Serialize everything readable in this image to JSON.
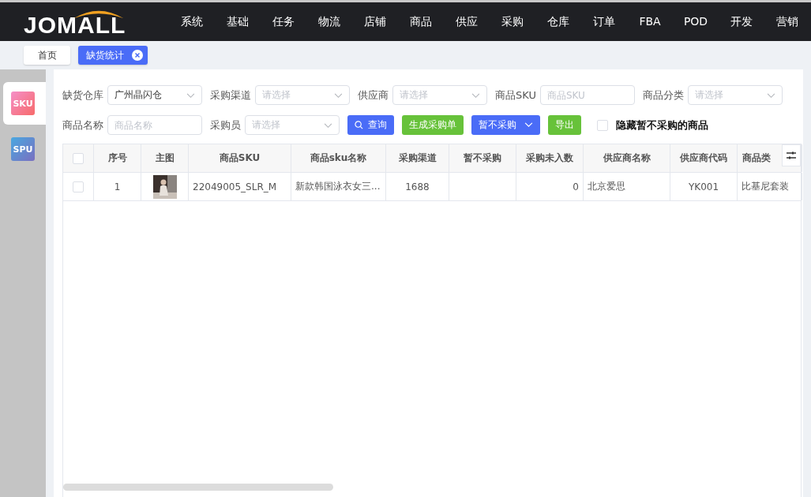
{
  "logo": {
    "text": "JOMALL"
  },
  "nav": [
    {
      "label": "系统"
    },
    {
      "label": "基础"
    },
    {
      "label": "任务"
    },
    {
      "label": "物流"
    },
    {
      "label": "店铺"
    },
    {
      "label": "商品"
    },
    {
      "label": "供应"
    },
    {
      "label": "采购"
    },
    {
      "label": "仓库"
    },
    {
      "label": "订单"
    },
    {
      "label": "FBA"
    },
    {
      "label": "POD"
    },
    {
      "label": "开发"
    },
    {
      "label": "营销"
    }
  ],
  "page_tabs": [
    {
      "label": "首页",
      "selected": false,
      "closable": false
    },
    {
      "label": "缺货统计",
      "selected": true,
      "closable": true
    }
  ],
  "side_tabs": [
    {
      "label": "SKU",
      "selected": true,
      "kind": "sku"
    },
    {
      "label": "SPU",
      "selected": false,
      "kind": "spu"
    }
  ],
  "filters": [
    {
      "label": "缺货仓库",
      "kind": "select",
      "value": "广州晶闪仓"
    },
    {
      "label": "采购渠道",
      "kind": "select",
      "placeholder": "请选择"
    },
    {
      "label": "供应商",
      "kind": "select",
      "placeholder": "请选择"
    },
    {
      "label": "商品SKU",
      "kind": "input",
      "placeholder": "商品SKU"
    },
    {
      "label": "商品分类",
      "kind": "select",
      "placeholder": "请选择"
    },
    {
      "label": "商品名称",
      "kind": "input",
      "placeholder": "商品名称"
    },
    {
      "label": "采购员",
      "kind": "select",
      "placeholder": "请选择"
    }
  ],
  "buttons": [
    {
      "label": "查询",
      "kind": "search"
    },
    {
      "label": "生成采购单",
      "kind": "green"
    },
    {
      "label": "暂不采购",
      "kind": "dropdown"
    },
    {
      "label": "导出",
      "kind": "green"
    }
  ],
  "hide_option": {
    "label": "隐藏暂不采购的商品",
    "checked": false
  },
  "table": {
    "all_checked": false,
    "columns": [
      "序号",
      "主图",
      "商品SKU",
      "商品sku名称",
      "采购渠道",
      "暂不采购",
      "采购未入数",
      "供应商名称",
      "供应商代码",
      "商品类"
    ],
    "rows": [
      {
        "checked": false,
        "cells": [
          "1",
          null,
          "22049005_SLR_M",
          "新款韩国泳衣女三...",
          "1688",
          "",
          "0",
          "北京爱思",
          "YK001",
          "比基尼套装"
        ]
      }
    ]
  }
}
